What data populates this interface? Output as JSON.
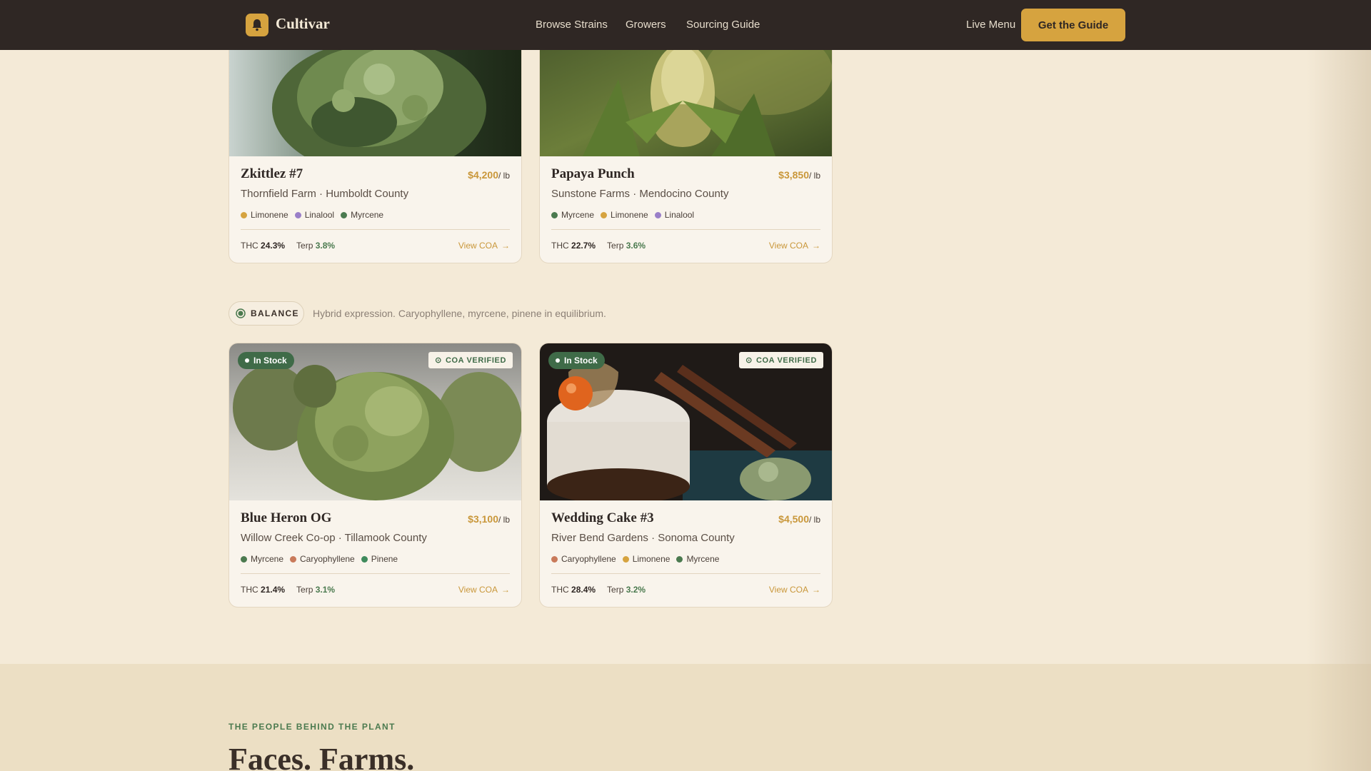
{
  "nav": {
    "brand": "Cultivar",
    "links": [
      "Browse Strains",
      "Growers",
      "Sourcing Guide"
    ],
    "live_menu": "Live Menu",
    "cta": "Get the Guide"
  },
  "section_balance": {
    "pill": "BALANCE",
    "description": "Hybrid expression. Caryophyllene, myrcene, pinene in equilibrium."
  },
  "labels": {
    "in_stock": "In Stock",
    "coa_verified": "COA VERIFIED",
    "unit": "/ lb",
    "thc": "THC",
    "terp": "Terp",
    "view_coa": "View COA"
  },
  "cards": [
    {
      "name": "Zkittlez #7",
      "price": "$4,200",
      "farm": "Thornfield Farm · Humboldt County",
      "terpenes": [
        {
          "name": "Limonene",
          "color": "#d6a33f"
        },
        {
          "name": "Linalool",
          "color": "#9a7fc8"
        },
        {
          "name": "Myrcene",
          "color": "#4b7a4f"
        }
      ],
      "thc": "24.3%",
      "terp": "3.8%"
    },
    {
      "name": "Papaya Punch",
      "price": "$3,850",
      "farm": "Sunstone Farms · Mendocino County",
      "terpenes": [
        {
          "name": "Myrcene",
          "color": "#4b7a4f"
        },
        {
          "name": "Limonene",
          "color": "#d6a33f"
        },
        {
          "name": "Linalool",
          "color": "#9a7fc8"
        }
      ],
      "thc": "22.7%",
      "terp": "3.6%"
    },
    {
      "name": "Blue Heron OG",
      "price": "$3,100",
      "farm": "Willow Creek Co-op · Tillamook County",
      "terpenes": [
        {
          "name": "Myrcene",
          "color": "#4b7a4f"
        },
        {
          "name": "Caryophyllene",
          "color": "#c97a5a"
        },
        {
          "name": "Pinene",
          "color": "#3f8a5c"
        }
      ],
      "thc": "21.4%",
      "terp": "3.1%"
    },
    {
      "name": "Wedding Cake #3",
      "price": "$4,500",
      "farm": "River Bend Gardens · Sonoma County",
      "terpenes": [
        {
          "name": "Caryophyllene",
          "color": "#c97a5a"
        },
        {
          "name": "Limonene",
          "color": "#d6a33f"
        },
        {
          "name": "Myrcene",
          "color": "#4b7a4f"
        }
      ],
      "thc": "28.4%",
      "terp": "3.2%"
    }
  ],
  "people": {
    "eyebrow": "THE PEOPLE BEHIND THE PLANT",
    "headline": "Faces. Farms."
  }
}
